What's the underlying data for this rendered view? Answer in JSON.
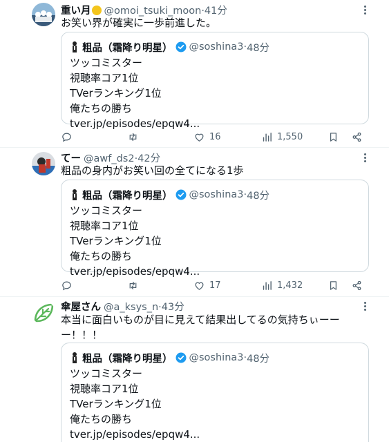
{
  "tweets": [
    {
      "name": "重い月",
      "handle": "@omoi_tsuki_moon",
      "dot": "·",
      "time": "41分",
      "body_lines": [
        "お笑い界が確実に一歩前進した。"
      ],
      "quote": {
        "name": "粗品（霜降り明星）",
        "handle": "@soshina3",
        "dot": "·",
        "time": "48分",
        "lines": [
          "ツッコミスター",
          "視聴率コア1位",
          "TVerランキング1位",
          "俺たちの勝ち",
          "tver.jp/episodes/epqw4..."
        ]
      },
      "likes": "16",
      "views": "1,550"
    },
    {
      "name": "てー",
      "handle": "@awf_ds2",
      "dot": "·",
      "time": "42分",
      "body_lines": [
        "粗品の身内がお笑い回の全てになる1歩"
      ],
      "quote": {
        "name": "粗品（霜降り明星）",
        "handle": "@soshina3",
        "dot": "·",
        "time": "48分",
        "lines": [
          "ツッコミスター",
          "視聴率コア1位",
          "TVerランキング1位",
          "俺たちの勝ち",
          "tver.jp/episodes/epqw4..."
        ]
      },
      "likes": "17",
      "views": "1,432"
    },
    {
      "name": "傘屋さん",
      "handle": "@a_ksys_n",
      "dot": "·",
      "time": "43分",
      "body_lines": [
        "本当に面白いものが目に見えて結果出してるの気持ちぃーー",
        "ー！！！"
      ],
      "quote": {
        "name": "粗品（霜降り明星）",
        "handle": "@soshina3",
        "dot": "·",
        "time": "48分",
        "lines": [
          "ツッコミスター",
          "視聴率コア1位",
          "TVerランキング1位",
          "俺たちの勝ち",
          "tver.jp/episodes/epqw4..."
        ]
      }
    }
  ],
  "colors": {
    "text": "#0f1419",
    "secondary": "#536471",
    "border": "#cfd9de",
    "verified": "#1d9bf0",
    "moon": "#f4c51c",
    "leaf": "#5cb85c"
  },
  "icons": [
    "reply-icon",
    "retweet-icon",
    "like-icon",
    "views-icon",
    "bookmark-icon",
    "share-icon",
    "more-icon",
    "verified-badge-icon",
    "moon-emoji-icon"
  ]
}
